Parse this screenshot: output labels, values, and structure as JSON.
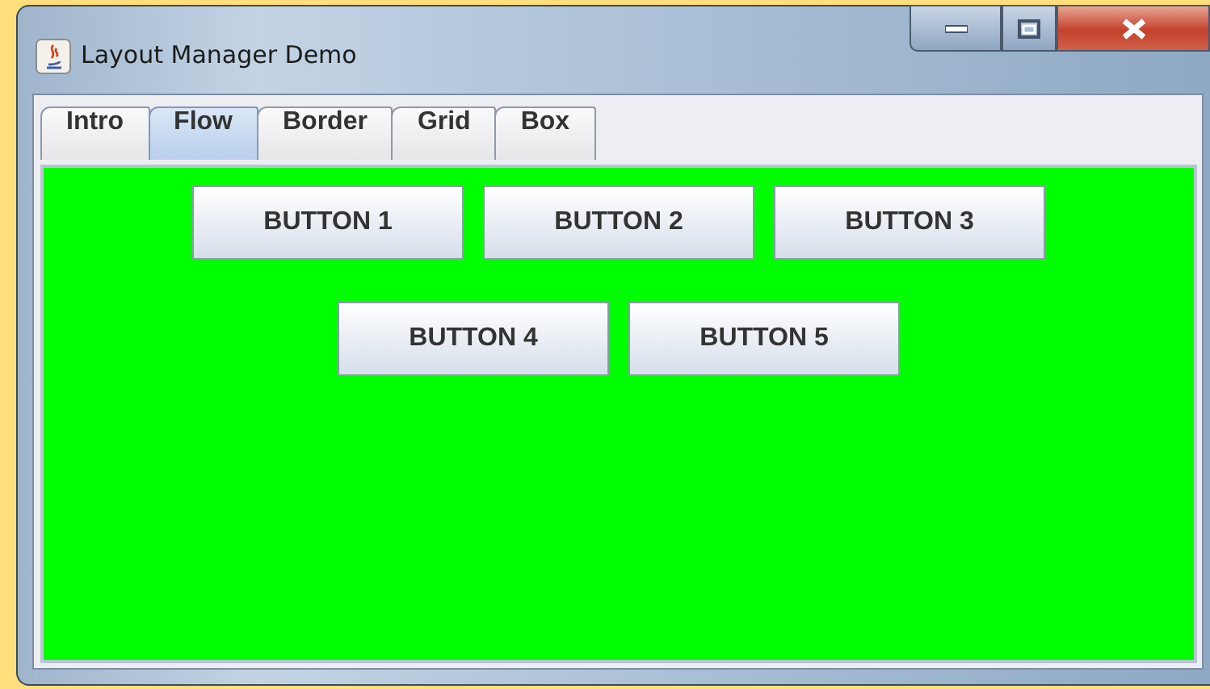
{
  "window": {
    "title": "Layout Manager Demo"
  },
  "tabs": [
    {
      "label": "Intro",
      "selected": false
    },
    {
      "label": "Flow",
      "selected": true
    },
    {
      "label": "Border",
      "selected": false
    },
    {
      "label": "Grid",
      "selected": false
    },
    {
      "label": "Box",
      "selected": false
    }
  ],
  "buttons": [
    "BUTTON 1",
    "BUTTON 2",
    "BUTTON 3",
    "BUTTON 4",
    "BUTTON 5"
  ]
}
